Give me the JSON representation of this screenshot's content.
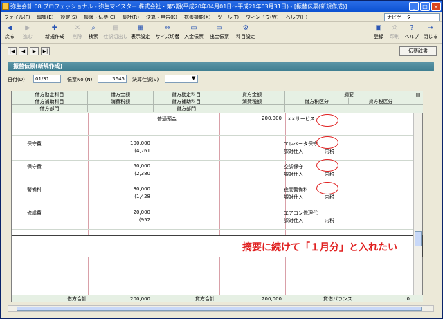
{
  "window": {
    "title": "弥生会計 08 プロフェッショナル - 弥生マイスター 株式会社・第5期(平成20年04月01日～平成21年03月31日) - [振替伝票(新規作成)]"
  },
  "menu": {
    "items": [
      "ファイル(F)",
      "編集(E)",
      "設定(S)",
      "帳簿・伝票(C)",
      "集計(R)",
      "決算・申告(K)",
      "拡張機能(X)",
      "ツール(T)",
      "ウィンドウ(W)",
      "ヘルプ(H)"
    ],
    "navi": "ナビゲータ"
  },
  "toolbar": {
    "back": "戻る",
    "forward": "進む",
    "new": "新規作成",
    "delete": "削除",
    "search": "検索",
    "import": "仕訳切出し",
    "display": "表示設定",
    "size": "サイズ切替",
    "in_slip": "入金伝票",
    "out_slip": "出金伝票",
    "account": "科目設定",
    "register": "登録",
    "print": "印刷",
    "help": "ヘルプ",
    "close": "閉じる"
  },
  "nav": {
    "first": "|◀",
    "prev": "◀",
    "next": "▶",
    "last": "▶|",
    "dictionary": "伝票辞書"
  },
  "panel": {
    "title": "振替伝票(新規作成)"
  },
  "filters": {
    "date_label": "日付(D)",
    "date_value": "01/31",
    "slip_label": "伝票No.(N)",
    "slip_value": "3645",
    "type_label": "決算仕訳(V)",
    "type_value": ""
  },
  "columns": {
    "row1": [
      "借方勘定科目",
      "借方金額",
      "貸方勘定科目",
      "貸方金額",
      "摘要"
    ],
    "row2": [
      "借方補助科目",
      "消費税額",
      "貸方補助科目",
      "消費税額",
      "借方税区分",
      "貸方税区分"
    ],
    "row3": [
      "借方部門",
      "貸方部門"
    ]
  },
  "rows": [
    {
      "debit_account": "",
      "debit_amount": "",
      "debit_tax": "",
      "credit_account": "普通預金",
      "credit_amount": "200,000",
      "summary": "××サービス",
      "tax_type": "",
      "tax_rule": ""
    },
    {
      "debit_account": "保守費",
      "debit_amount": "100,000",
      "debit_tax": "(4,761",
      "credit_account": "",
      "credit_amount": "",
      "summary": "エレベータ保守",
      "tax_type": "課対仕入",
      "tax_rule": "内税"
    },
    {
      "debit_account": "保守費",
      "debit_amount": "50,000",
      "debit_tax": "(2,380",
      "credit_account": "",
      "credit_amount": "",
      "summary": "空調保守",
      "tax_type": "課対仕入",
      "tax_rule": "内税"
    },
    {
      "debit_account": "警備料",
      "debit_amount": "30,000",
      "debit_tax": "(1,428",
      "credit_account": "",
      "credit_amount": "",
      "summary": "夜間警備料",
      "tax_type": "課対仕入",
      "tax_rule": "内税"
    },
    {
      "debit_account": "修繕費",
      "debit_amount": "20,000",
      "debit_tax": "(952",
      "credit_account": "",
      "credit_amount": "",
      "summary": "エアコン修理代",
      "tax_type": "課対仕入",
      "tax_rule": "内税"
    }
  ],
  "annotation": "摘要に続けて「１月分」と入れたい",
  "footer": {
    "debit_total_label": "借方合計",
    "debit_total": "200,000",
    "credit_total_label": "貸方合計",
    "credit_total": "200,000",
    "balance_label": "貸借バランス",
    "balance": "0"
  },
  "colors": {
    "accent": "#3e7d90",
    "highlight": "#e02020"
  }
}
